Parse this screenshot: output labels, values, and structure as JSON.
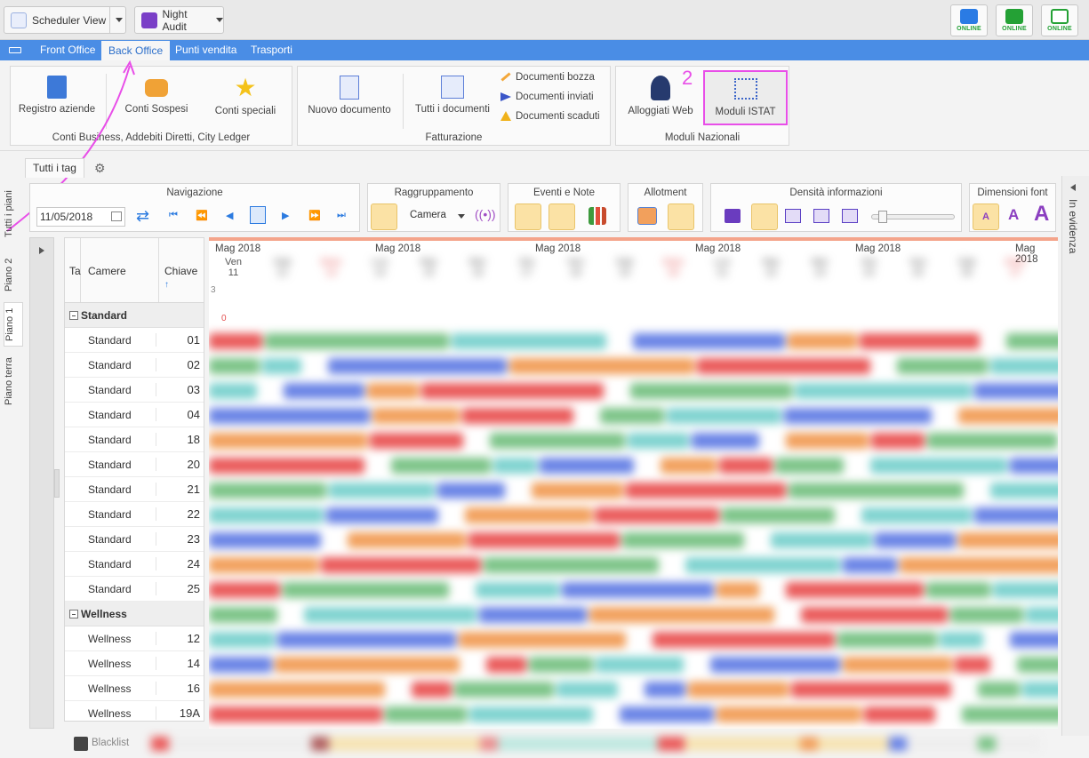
{
  "topbar": {
    "scheduler_view": "Scheduler View",
    "night_audit": "Night Audit",
    "status": [
      "ONLINE",
      "ONLINE",
      "ONLINE"
    ]
  },
  "tabs": [
    "Front Office",
    "Back Office",
    "Punti vendita",
    "Trasporti"
  ],
  "active_tab": "Back Office",
  "ribbon": {
    "group1": {
      "label": "Conti Business, Addebiti Diretti, City Ledger",
      "buttons": [
        "Registro aziende",
        "Conti Sospesi",
        "Conti speciali"
      ]
    },
    "group2": {
      "label": "Fatturazione",
      "buttons": [
        "Nuovo documento",
        "Tutti i documenti"
      ],
      "small": [
        "Documenti bozza",
        "Documenti inviati",
        "Documenti scaduti"
      ]
    },
    "group3": {
      "label": "Moduli Nazionali",
      "buttons": [
        "Alloggiati Web",
        "Moduli ISTAT"
      ]
    },
    "annotation": "2"
  },
  "tag_tab": "Tutti i tag",
  "left_tabs": [
    "Tutti i piani",
    "Piano 2",
    "Piano 1",
    "Piano terra"
  ],
  "toolbar": {
    "navigazione": "Navigazione",
    "date": "11/05/2018",
    "raggruppamento": "Raggruppamento",
    "group_value": "Camera",
    "eventi": "Eventi e Note",
    "allotment": "Allotment",
    "densita": "Densità informazioni",
    "dimensioni": "Dimensioni font",
    "font_sizes": [
      "A",
      "A",
      "A"
    ]
  },
  "right_panel": "In evidenza",
  "table": {
    "col_t": "Ta",
    "col_camere": "Camere",
    "col_chiave": "Chiave",
    "groups": [
      {
        "name": "Standard",
        "rooms": [
          {
            "type": "Standard",
            "key": "01"
          },
          {
            "type": "Standard",
            "key": "02"
          },
          {
            "type": "Standard",
            "key": "03"
          },
          {
            "type": "Standard",
            "key": "04"
          },
          {
            "type": "Standard",
            "key": "18"
          },
          {
            "type": "Standard",
            "key": "20"
          },
          {
            "type": "Standard",
            "key": "21"
          },
          {
            "type": "Standard",
            "key": "22"
          },
          {
            "type": "Standard",
            "key": "23"
          },
          {
            "type": "Standard",
            "key": "24"
          },
          {
            "type": "Standard",
            "key": "25"
          }
        ]
      },
      {
        "name": "Wellness",
        "rooms": [
          {
            "type": "Wellness",
            "key": "12"
          },
          {
            "type": "Wellness",
            "key": "14"
          },
          {
            "type": "Wellness",
            "key": "16"
          },
          {
            "type": "Wellness",
            "key": "19A"
          }
        ]
      }
    ]
  },
  "calendar": {
    "month_labels": [
      "Mag 2018",
      "Mag 2018",
      "Mag 2018",
      "Mag 2018",
      "Mag 2018",
      "Mag 2018"
    ],
    "days": [
      {
        "d": "Ven",
        "n": "11"
      },
      {
        "d": "Sab",
        "n": "12"
      },
      {
        "d": "Dom",
        "n": "13"
      },
      {
        "d": "Lun",
        "n": "14"
      },
      {
        "d": "Mar",
        "n": "15"
      },
      {
        "d": "Mer",
        "n": "16"
      },
      {
        "d": "Gio",
        "n": "17"
      },
      {
        "d": "Ven",
        "n": "18"
      },
      {
        "d": "Sab",
        "n": "19"
      },
      {
        "d": "Dom",
        "n": "20"
      },
      {
        "d": "Lun",
        "n": "21"
      },
      {
        "d": "Mar",
        "n": "22"
      },
      {
        "d": "Mer",
        "n": "23"
      },
      {
        "d": "Gio",
        "n": "24"
      },
      {
        "d": "Ven",
        "n": "25"
      },
      {
        "d": "Sab",
        "n": "26"
      },
      {
        "d": "Dom",
        "n": "27"
      }
    ],
    "avail_top": "3",
    "avail_bottom": "0"
  },
  "bottom": {
    "blacklist": "Blacklist"
  },
  "colors": {
    "accent": "#4a8de5",
    "highlight": "#e84ee8",
    "red": "#ea5a5a",
    "blue": "#6a84e6",
    "green": "#7cc488",
    "orange": "#f2a05c"
  }
}
